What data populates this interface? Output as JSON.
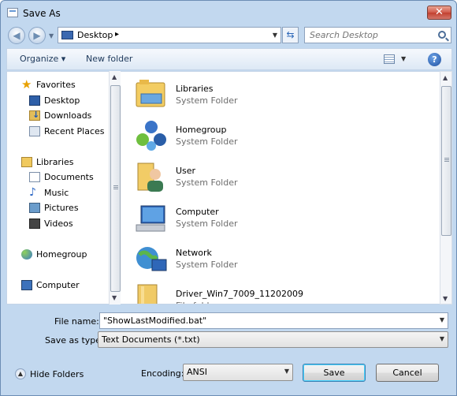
{
  "window": {
    "title": "Save As",
    "close_label": "✕"
  },
  "address": {
    "location": "Desktop",
    "separator": "▸"
  },
  "search": {
    "placeholder": "Search Desktop"
  },
  "toolbar": {
    "organize_label": "Organize ▾",
    "new_folder_label": "New folder",
    "help_label": "?"
  },
  "nav_tree": {
    "favorites": "Favorites",
    "favorites_items": [
      "Desktop",
      "Downloads",
      "Recent Places"
    ],
    "libraries": "Libraries",
    "libraries_items": [
      "Documents",
      "Music",
      "Pictures",
      "Videos"
    ],
    "homegroup": "Homegroup",
    "computer": "Computer"
  },
  "files": [
    {
      "name": "Libraries",
      "type": "System Folder",
      "icon": "libraries-folder-icon"
    },
    {
      "name": "Homegroup",
      "type": "System Folder",
      "icon": "homegroup-icon"
    },
    {
      "name": "User",
      "type": "System Folder",
      "icon": "user-folder-icon"
    },
    {
      "name": "Computer",
      "type": "System Folder",
      "icon": "computer-icon"
    },
    {
      "name": "Network",
      "type": "System Folder",
      "icon": "network-icon"
    },
    {
      "name": "Driver_Win7_7009_11202009",
      "type": "File folder",
      "icon": "folder-icon"
    }
  ],
  "form": {
    "file_name_label": "File name:",
    "file_name_value": "\"ShowLastModified.bat\"",
    "save_as_type_label": "Save as type:",
    "save_as_type_value": "Text Documents (*.txt)",
    "encoding_label": "Encoding:",
    "encoding_value": "ANSI"
  },
  "footer": {
    "hide_folders_label": "Hide Folders",
    "save_label": "Save",
    "cancel_label": "Cancel"
  }
}
